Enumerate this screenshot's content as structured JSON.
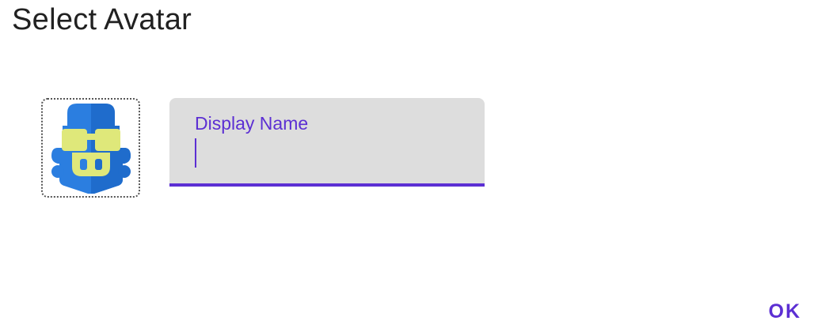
{
  "dialog": {
    "title": "Select Avatar"
  },
  "avatar": {
    "icon": "mascot-avatar-icon",
    "colors": {
      "body": "#2b7ee0",
      "body_shade": "#1f6ccc",
      "glasses": "#dfe87a"
    }
  },
  "display_name": {
    "label": "Display Name",
    "value": "",
    "placeholder": ""
  },
  "actions": {
    "ok_label": "OK"
  },
  "theme": {
    "accent": "#5c2fd3",
    "field_background": "#dddddd",
    "title_color": "#212121"
  }
}
